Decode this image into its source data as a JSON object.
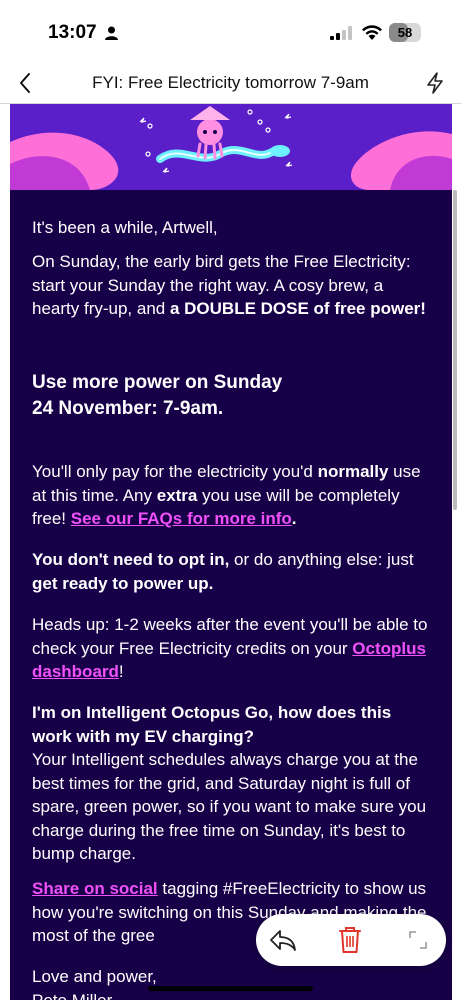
{
  "status_bar": {
    "time": "13:07",
    "battery": "58",
    "battery_level": 0.58
  },
  "nav": {
    "title": "FYI: Free Electricity tomorrow 7-9am"
  },
  "email": {
    "greeting": "It's been a while, Artwell,",
    "intro_text": "On Sunday, the early bird gets the Free Electricity: start your Sunday the right way. A cosy brew, a hearty fry-up, and ",
    "intro_bold": "a DOUBLE DOSE of free power!",
    "heading_line1": "Use more power on Sunday",
    "heading_line2": "24 November: 7-9am.",
    "pay_1": "You'll only pay for the electricity you'd ",
    "pay_bold1": "normally",
    "pay_2": " use at this time. Any ",
    "pay_bold2": "extra",
    "pay_3": " you use will be completely free! ",
    "faq_link": "See our FAQs for more info",
    "faq_after": ".",
    "optin_bold": "You don't need to opt in,",
    "optin_text": " or do anything else: just ",
    "optin_bold2": "get ready to power up.",
    "headsup_text": "Heads up: 1-2 weeks after the event you'll be able to check your Free Electricity credits on your ",
    "octoplus_link": "Octoplus dashboard",
    "headsup_after": "!",
    "ev_question": "I'm on Intelligent Octopus Go, how does this work with my EV charging?",
    "ev_answer": "Your Intelligent schedules always charge you at the best times for the grid, and Saturday night is full of spare, green power, so if you want to make sure you charge during the free time on Sunday, it's best to bump charge.",
    "share_link": "Share on social",
    "share_text": " tagging #FreeElectricity to show us how you're switching on this Sunday and making the most of the gree",
    "signoff": "Love and power,",
    "signature": "Pete Miller"
  },
  "colors": {
    "email_bg": "#180048",
    "banner_bg": "#5a1fc9",
    "link": "#f050f8",
    "delete": "#e0362c"
  },
  "icons": {
    "back": "chevron-left-icon",
    "bolt": "lightning-icon",
    "reply": "reply-icon",
    "trash": "trash-icon",
    "expand": "expand-icon"
  }
}
